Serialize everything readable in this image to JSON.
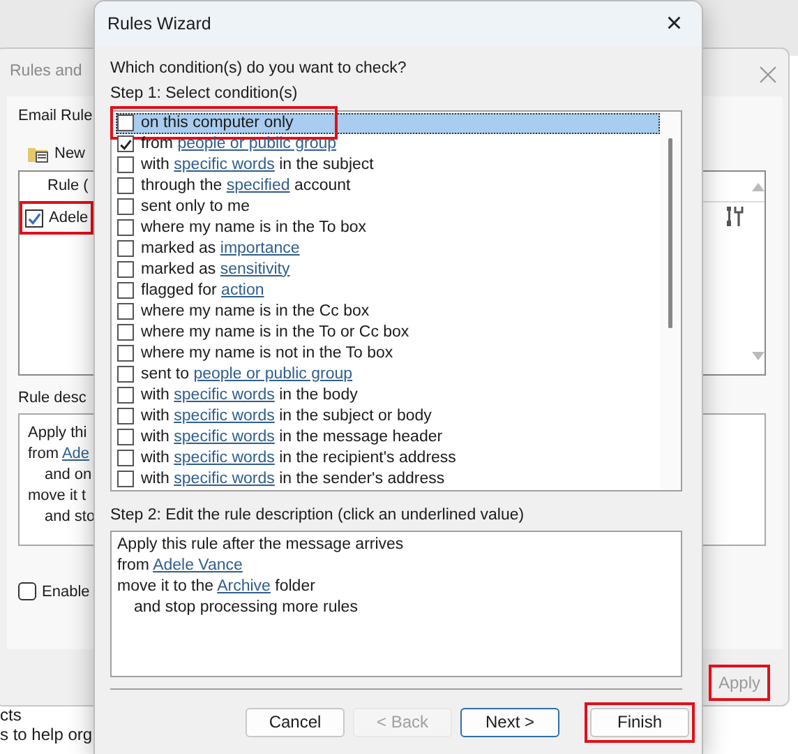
{
  "background_window": {
    "title": "Rules and",
    "tab": "Email Rule",
    "new_rule": "New",
    "list_header": "Rule (",
    "rules": [
      {
        "name": "Adele",
        "checked": true,
        "highlighted": true
      }
    ],
    "description_label": "Rule desc",
    "description_lines": [
      {
        "indented": false,
        "parts": [
          {
            "text": "Apply thi"
          }
        ]
      },
      {
        "indented": false,
        "parts": [
          {
            "text": "from "
          },
          {
            "text": "Ade",
            "link": true
          }
        ]
      },
      {
        "indented": true,
        "parts": [
          {
            "text": "and on"
          }
        ]
      },
      {
        "indented": false,
        "parts": [
          {
            "text": "move it t"
          }
        ]
      },
      {
        "indented": true,
        "parts": [
          {
            "text": "and sto"
          }
        ]
      }
    ],
    "enable": {
      "label": "Enable",
      "checked": false
    },
    "apply_button": {
      "label": "Apply",
      "disabled": true,
      "highlighted": true
    }
  },
  "page_behind": [
    "cts",
    "s to help org"
  ],
  "wizard": {
    "title": "Rules Wizard",
    "close": "×",
    "question": "Which condition(s) do you want to check?",
    "step1": "Step 1: Select condition(s)",
    "conditions": [
      {
        "selected": true,
        "checked": false,
        "highlighted": true,
        "parts": [
          {
            "text": "on this computer only"
          }
        ]
      },
      {
        "selected": false,
        "checked": true,
        "highlighted": false,
        "parts": [
          {
            "text": "from "
          },
          {
            "text": "people or public group",
            "link": true
          }
        ]
      },
      {
        "selected": false,
        "checked": false,
        "highlighted": false,
        "parts": [
          {
            "text": "with "
          },
          {
            "text": "specific words",
            "link": true
          },
          {
            "text": " in the subject"
          }
        ]
      },
      {
        "selected": false,
        "checked": false,
        "highlighted": false,
        "parts": [
          {
            "text": "through the "
          },
          {
            "text": "specified",
            "link": true
          },
          {
            "text": " account"
          }
        ]
      },
      {
        "selected": false,
        "checked": false,
        "highlighted": false,
        "parts": [
          {
            "text": "sent only to me"
          }
        ]
      },
      {
        "selected": false,
        "checked": false,
        "highlighted": false,
        "parts": [
          {
            "text": "where my name is in the To box"
          }
        ]
      },
      {
        "selected": false,
        "checked": false,
        "highlighted": false,
        "parts": [
          {
            "text": "marked as "
          },
          {
            "text": "importance",
            "link": true
          }
        ]
      },
      {
        "selected": false,
        "checked": false,
        "highlighted": false,
        "parts": [
          {
            "text": "marked as "
          },
          {
            "text": "sensitivity",
            "link": true
          }
        ]
      },
      {
        "selected": false,
        "checked": false,
        "highlighted": false,
        "parts": [
          {
            "text": "flagged for "
          },
          {
            "text": "action",
            "link": true
          }
        ]
      },
      {
        "selected": false,
        "checked": false,
        "highlighted": false,
        "parts": [
          {
            "text": "where my name is in the Cc box"
          }
        ]
      },
      {
        "selected": false,
        "checked": false,
        "highlighted": false,
        "parts": [
          {
            "text": "where my name is in the To or Cc box"
          }
        ]
      },
      {
        "selected": false,
        "checked": false,
        "highlighted": false,
        "parts": [
          {
            "text": "where my name is not in the To box"
          }
        ]
      },
      {
        "selected": false,
        "checked": false,
        "highlighted": false,
        "parts": [
          {
            "text": "sent to "
          },
          {
            "text": "people or public group",
            "link": true
          }
        ]
      },
      {
        "selected": false,
        "checked": false,
        "highlighted": false,
        "parts": [
          {
            "text": "with "
          },
          {
            "text": "specific words",
            "link": true
          },
          {
            "text": " in the body"
          }
        ]
      },
      {
        "selected": false,
        "checked": false,
        "highlighted": false,
        "parts": [
          {
            "text": "with "
          },
          {
            "text": "specific words",
            "link": true
          },
          {
            "text": " in the subject or body"
          }
        ]
      },
      {
        "selected": false,
        "checked": false,
        "highlighted": false,
        "parts": [
          {
            "text": "with "
          },
          {
            "text": "specific words",
            "link": true
          },
          {
            "text": " in the message header"
          }
        ]
      },
      {
        "selected": false,
        "checked": false,
        "highlighted": false,
        "parts": [
          {
            "text": "with "
          },
          {
            "text": "specific words",
            "link": true
          },
          {
            "text": " in the recipient's address"
          }
        ]
      },
      {
        "selected": false,
        "checked": false,
        "highlighted": false,
        "parts": [
          {
            "text": "with "
          },
          {
            "text": "specific words",
            "link": true
          },
          {
            "text": " in the sender's address"
          }
        ]
      }
    ],
    "step2": "Step 2: Edit the rule description (click an underlined value)",
    "description_lines": [
      {
        "indented": false,
        "parts": [
          {
            "text": "Apply this rule after the message arrives"
          }
        ]
      },
      {
        "indented": false,
        "parts": [
          {
            "text": "from "
          },
          {
            "text": "Adele Vance",
            "link": true
          }
        ]
      },
      {
        "indented": false,
        "parts": [
          {
            "text": "move it to the "
          },
          {
            "text": "Archive",
            "link": true
          },
          {
            "text": " folder"
          }
        ]
      },
      {
        "indented": true,
        "parts": [
          {
            "text": "and stop processing more rules"
          }
        ]
      }
    ],
    "buttons": [
      {
        "label": "Cancel",
        "disabled": false,
        "default": false,
        "highlighted": false
      },
      {
        "label": "< Back",
        "disabled": true,
        "default": false,
        "highlighted": false
      },
      {
        "label": "Next >",
        "disabled": false,
        "default": true,
        "highlighted": false
      },
      {
        "label": "Finish",
        "disabled": false,
        "default": false,
        "highlighted": true
      }
    ]
  }
}
